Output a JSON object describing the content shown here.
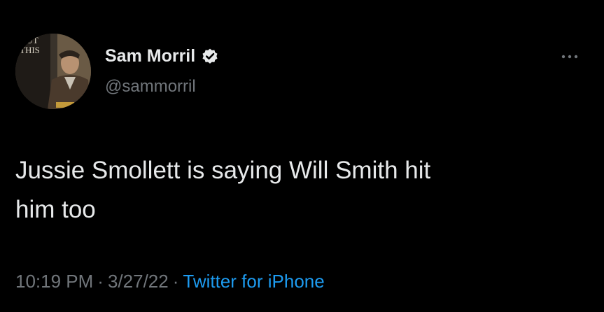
{
  "author": {
    "display_name": "Sam Morril",
    "handle": "@sammorril",
    "verified": true,
    "avatar_text": [
      "OUT",
      "THIS"
    ]
  },
  "tweet": {
    "text_line1": "Jussie Smollett is saying Will Smith hit",
    "text_line2": "him too"
  },
  "meta": {
    "time": "10:19 PM",
    "separator": "·",
    "date": "3/27/22",
    "source": "Twitter for iPhone"
  },
  "icons": {
    "verified": "verified-badge-icon",
    "more": "more-options-icon"
  },
  "colors": {
    "background": "#000000",
    "primary_text": "#e7e9ea",
    "secondary_text": "#71767b",
    "link": "#1d9bf0"
  }
}
